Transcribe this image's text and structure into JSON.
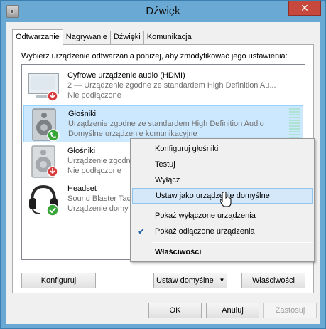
{
  "window": {
    "title": "Dźwięk",
    "close_glyph": "✕"
  },
  "tabs": [
    {
      "label": "Odtwarzanie",
      "active": true
    },
    {
      "label": "Nagrywanie",
      "active": false
    },
    {
      "label": "Dźwięki",
      "active": false
    },
    {
      "label": "Komunikacja",
      "active": false
    }
  ],
  "instruction": "Wybierz urządzenie odtwarzania poniżej, aby zmodyfikować jego ustawienia:",
  "devices": [
    {
      "name": "Cyfrowe urządzenie audio (HDMI)",
      "desc": "2 — Urządzenie zgodne ze standardem High Definition Au...",
      "status": "Nie podłączone",
      "icon": "monitor-icon",
      "badge": "disconnected-badge",
      "selected": false
    },
    {
      "name": "Głośniki",
      "desc": "Urządzenie zgodne ze standardem High Definition Audio",
      "status": "Domyślne urządzenie komunikacyjne",
      "icon": "speaker-icon",
      "badge": "phone-badge",
      "selected": true
    },
    {
      "name": "Głośniki",
      "desc": "Urządzenie zgodne ze sta",
      "status": "Nie podłączone",
      "icon": "speaker-icon",
      "badge": "disconnected-badge",
      "selected": false
    },
    {
      "name": "Headset",
      "desc": "Sound Blaster Tac",
      "status": "Urządzenie domy",
      "icon": "headset-icon",
      "badge": "default-check-badge",
      "selected": false
    }
  ],
  "buttons": {
    "configure": "Konfiguruj",
    "set_default": "Ustaw domyślne",
    "split_arrow": "▼",
    "properties": "Właściwości",
    "ok": "OK",
    "cancel": "Anuluj",
    "apply": "Zastosuj"
  },
  "context_menu": {
    "items": [
      {
        "label": "Konfiguruj głośniki"
      },
      {
        "label": "Testuj"
      },
      {
        "label": "Wyłącz"
      },
      {
        "label": "Ustaw jako urządzenie domyślne",
        "hover": true
      },
      {
        "label": "Pokaż wyłączone urządzenia"
      },
      {
        "label": "Pokaż odłączone urządzenia",
        "checked": true,
        "check_glyph": "✔"
      },
      {
        "label": "Właściwości",
        "bold": true
      }
    ]
  },
  "colors": {
    "frame": "#6aa9d3",
    "close_button": "#c7483c",
    "selection": "#cce8ff",
    "menu_hover": "#d5e8f9"
  }
}
